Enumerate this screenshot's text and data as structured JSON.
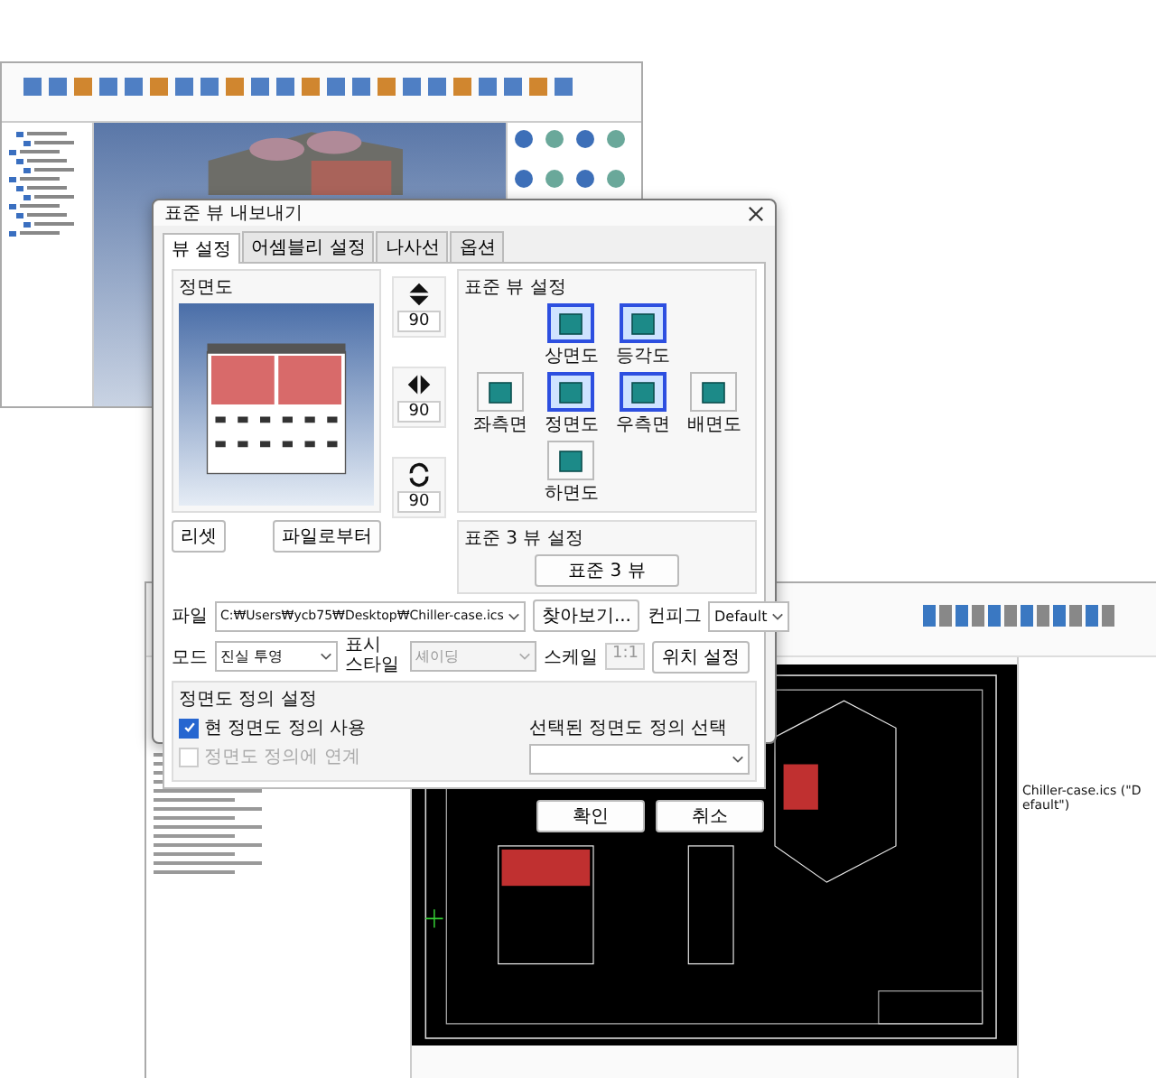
{
  "bottom_window": {
    "tree_item": "Chiller-case.ics (\"Default\")"
  },
  "dialog": {
    "title": "표준 뷰 내보내기",
    "tabs": [
      {
        "label": "뷰 설정",
        "selected": true
      },
      {
        "label": "어셈블리 설정",
        "selected": false
      },
      {
        "label": "나사선",
        "selected": false
      },
      {
        "label": "옵션",
        "selected": false
      }
    ],
    "preview_title": "정면도",
    "reset_button": "리셋",
    "from_file_button": "파일로부터",
    "rotations": [
      {
        "kind": "vertical",
        "value": "90"
      },
      {
        "kind": "horizontal",
        "value": "90"
      },
      {
        "kind": "spin",
        "value": "90"
      }
    ],
    "standard_views": {
      "title": "표준 뷰 설정",
      "views": [
        {
          "label": "상면도",
          "selected": true
        },
        {
          "label": "등각도",
          "selected": true
        },
        {
          "label": "좌측면",
          "selected": false
        },
        {
          "label": "정면도",
          "selected": true
        },
        {
          "label": "우측면",
          "selected": true
        },
        {
          "label": "배면도",
          "selected": false
        },
        {
          "label": "하면도",
          "selected": false
        }
      ]
    },
    "three_view": {
      "title": "표준 3 뷰 설정",
      "button": "표준 3 뷰"
    },
    "file": {
      "label": "파일",
      "value": "C:₩Users₩ycb75₩Desktop₩Chiller-case.ics",
      "browse_button": "찾아보기...",
      "config_label": "컨피그",
      "config_value": "Default"
    },
    "mode": {
      "label": "모드",
      "value": "진실 투영",
      "style_label": "표시 스타일",
      "style_value": "셰이딩",
      "scale_label": "스케일",
      "scale_value": "1:1",
      "position_button": "위치 설정"
    },
    "front_definition": {
      "title": "정면도 정의 설정",
      "options": [
        {
          "label": "현 정면도 정의 사용",
          "checked": true,
          "disabled": false
        },
        {
          "label": "정면도 정의에 연계",
          "checked": false,
          "disabled": true
        }
      ],
      "select_label": "선택된 정면도 정의 선택"
    },
    "buttons": [
      "확인",
      "취소"
    ]
  }
}
